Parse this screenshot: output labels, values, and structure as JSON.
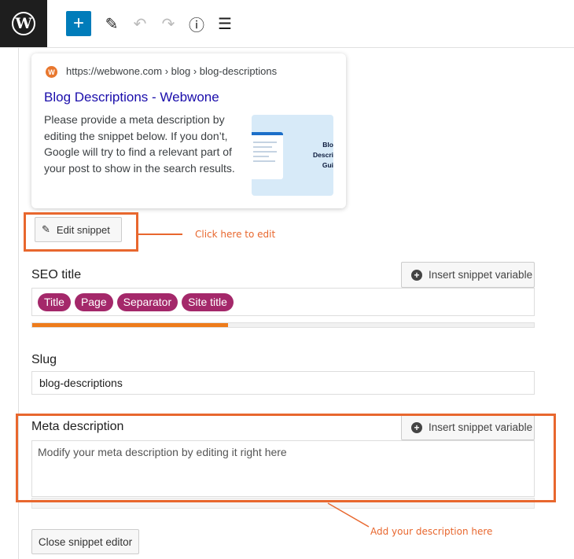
{
  "toolbar": {
    "logo_glyph": "W",
    "add_glyph": "+",
    "pen_glyph": "✎",
    "undo_glyph": "↶",
    "redo_glyph": "↷",
    "info_glyph": "ⓘ",
    "list_glyph": "☰"
  },
  "preview": {
    "favicon_glyph": "W",
    "url": "https://webwone.com › blog › blog-descriptions",
    "title": "Blog Descriptions - Webwone",
    "description": "Please provide a meta description by editing the snippet below. If you don’t, Google will try to find a relevant part of your post to show in the search results.",
    "thumbnail_lines": [
      "Blo",
      "Descri",
      "Gui"
    ]
  },
  "edit_snippet": {
    "icon_glyph": "✎",
    "label": "Edit snippet"
  },
  "annotations": {
    "edit_callout": "Click here to edit",
    "description_callout": "Add your description here",
    "color": "#e8672e"
  },
  "seo_title": {
    "label": "SEO title",
    "insert_variable_label": "Insert snippet variable",
    "pills": [
      "Title",
      "Page",
      "Separator",
      "Site title"
    ],
    "pill_color": "#a4286a",
    "progress_fraction": 0.39,
    "progress_color": "#ee7c1b"
  },
  "slug": {
    "label": "Slug",
    "value": "blog-descriptions"
  },
  "meta_description": {
    "label": "Meta description",
    "insert_variable_label": "Insert snippet variable",
    "placeholder": "Modify your meta description by editing it right here"
  },
  "close_editor_label": "Close snippet editor",
  "plus_glyph": "+",
  "accent_color": "#007cba"
}
